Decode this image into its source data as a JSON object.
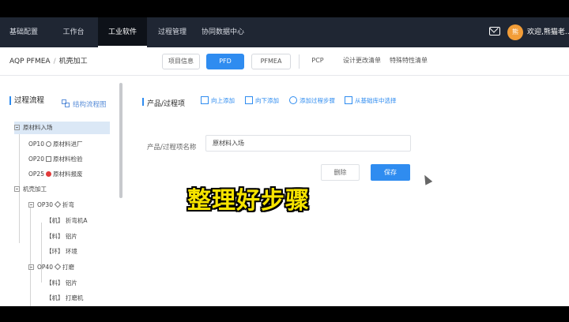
{
  "topbar": {
    "nav": [
      "基础配置",
      "工作台",
      "工业软件",
      "过程管理",
      "协同数据中心"
    ],
    "active_index": 2,
    "avatar_text": "熊",
    "welcome": "欢迎,熊猫老..."
  },
  "subbar": {
    "breadcrumb": [
      "AQP PFMEA",
      "机壳加工"
    ],
    "tabs": [
      "项目信息",
      "PFD",
      "PFMEA",
      "PCP",
      "设计更改清单",
      "特殊特性清单"
    ],
    "active_tab": "PFD"
  },
  "sidebar": {
    "title": "过程流程",
    "flow_label": "结构流程图",
    "tree": [
      {
        "label": "原材料入场",
        "selected": true
      },
      {
        "code": "OP10",
        "marker": "circle",
        "label": "原材料进厂"
      },
      {
        "code": "OP20",
        "marker": "square",
        "label": "原材料检验"
      },
      {
        "code": "OP25",
        "marker": "red-dot",
        "label": "原材料报废"
      },
      {
        "label": "机壳加工"
      },
      {
        "code": "OP30",
        "marker": "diamond",
        "label": "折弯"
      },
      {
        "label": "【机】 折弯机A"
      },
      {
        "label": "【料】 铝片"
      },
      {
        "label": "【环】 环境"
      },
      {
        "code": "OP40",
        "marker": "diamond",
        "label": "打磨"
      },
      {
        "label": "【料】 铝片"
      },
      {
        "label": "【机】 打磨机"
      }
    ]
  },
  "main": {
    "section_title": "产品/过程项",
    "actions": [
      "向上添加",
      "向下添加",
      "添加过程步骤",
      "从基础库中选择"
    ],
    "field_label": "产品/过程项名称",
    "field_value": "原材料入场",
    "delete_label": "删除",
    "save_label": "保存"
  },
  "caption": "整理好步骤",
  "colors": {
    "accent": "#2f8cf0",
    "topbar": "#1f2633",
    "caption": "#f6e300",
    "danger": "#e23b3b"
  }
}
